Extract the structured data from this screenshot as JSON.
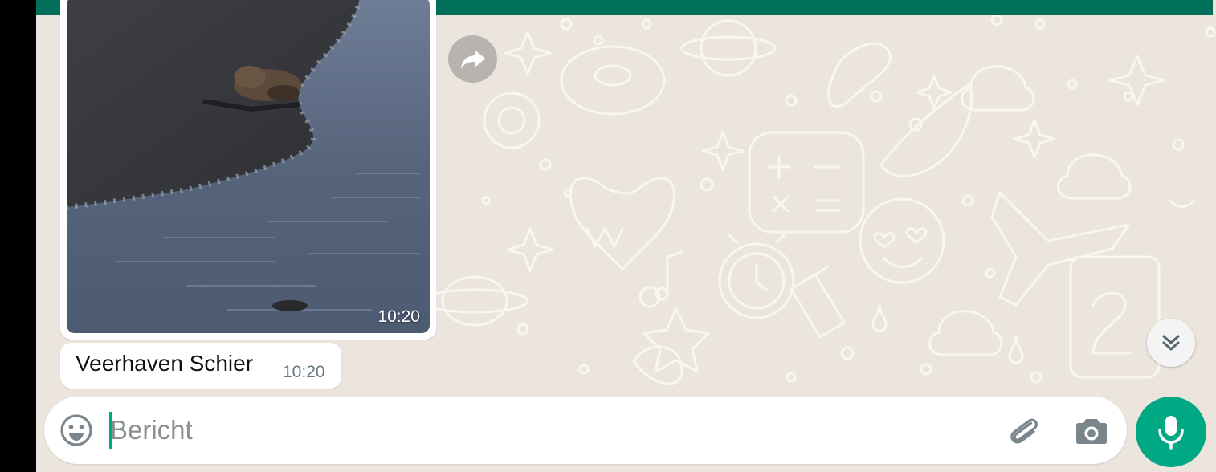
{
  "colors": {
    "header_green": "#00705a",
    "accent_green": "#00a884",
    "chat_background": "#ece5dd",
    "bubble_white": "#ffffff",
    "timestamp_gray": "#667781"
  },
  "messages": [
    {
      "type": "image",
      "image_desc": "seal on a sandy beach at the water's edge",
      "time": "10:20"
    },
    {
      "type": "text",
      "text": "Veerhaven Schier",
      "time": "10:20"
    }
  ],
  "actions": {
    "forward_icon": "forward-icon",
    "scroll_down_icon": "double-chevron-down-icon"
  },
  "composer": {
    "placeholder": "Bericht",
    "value": "",
    "emoji_icon": "emoji-icon",
    "attach_icon": "paperclip-icon",
    "camera_icon": "camera-icon",
    "mic_icon": "microphone-icon"
  }
}
